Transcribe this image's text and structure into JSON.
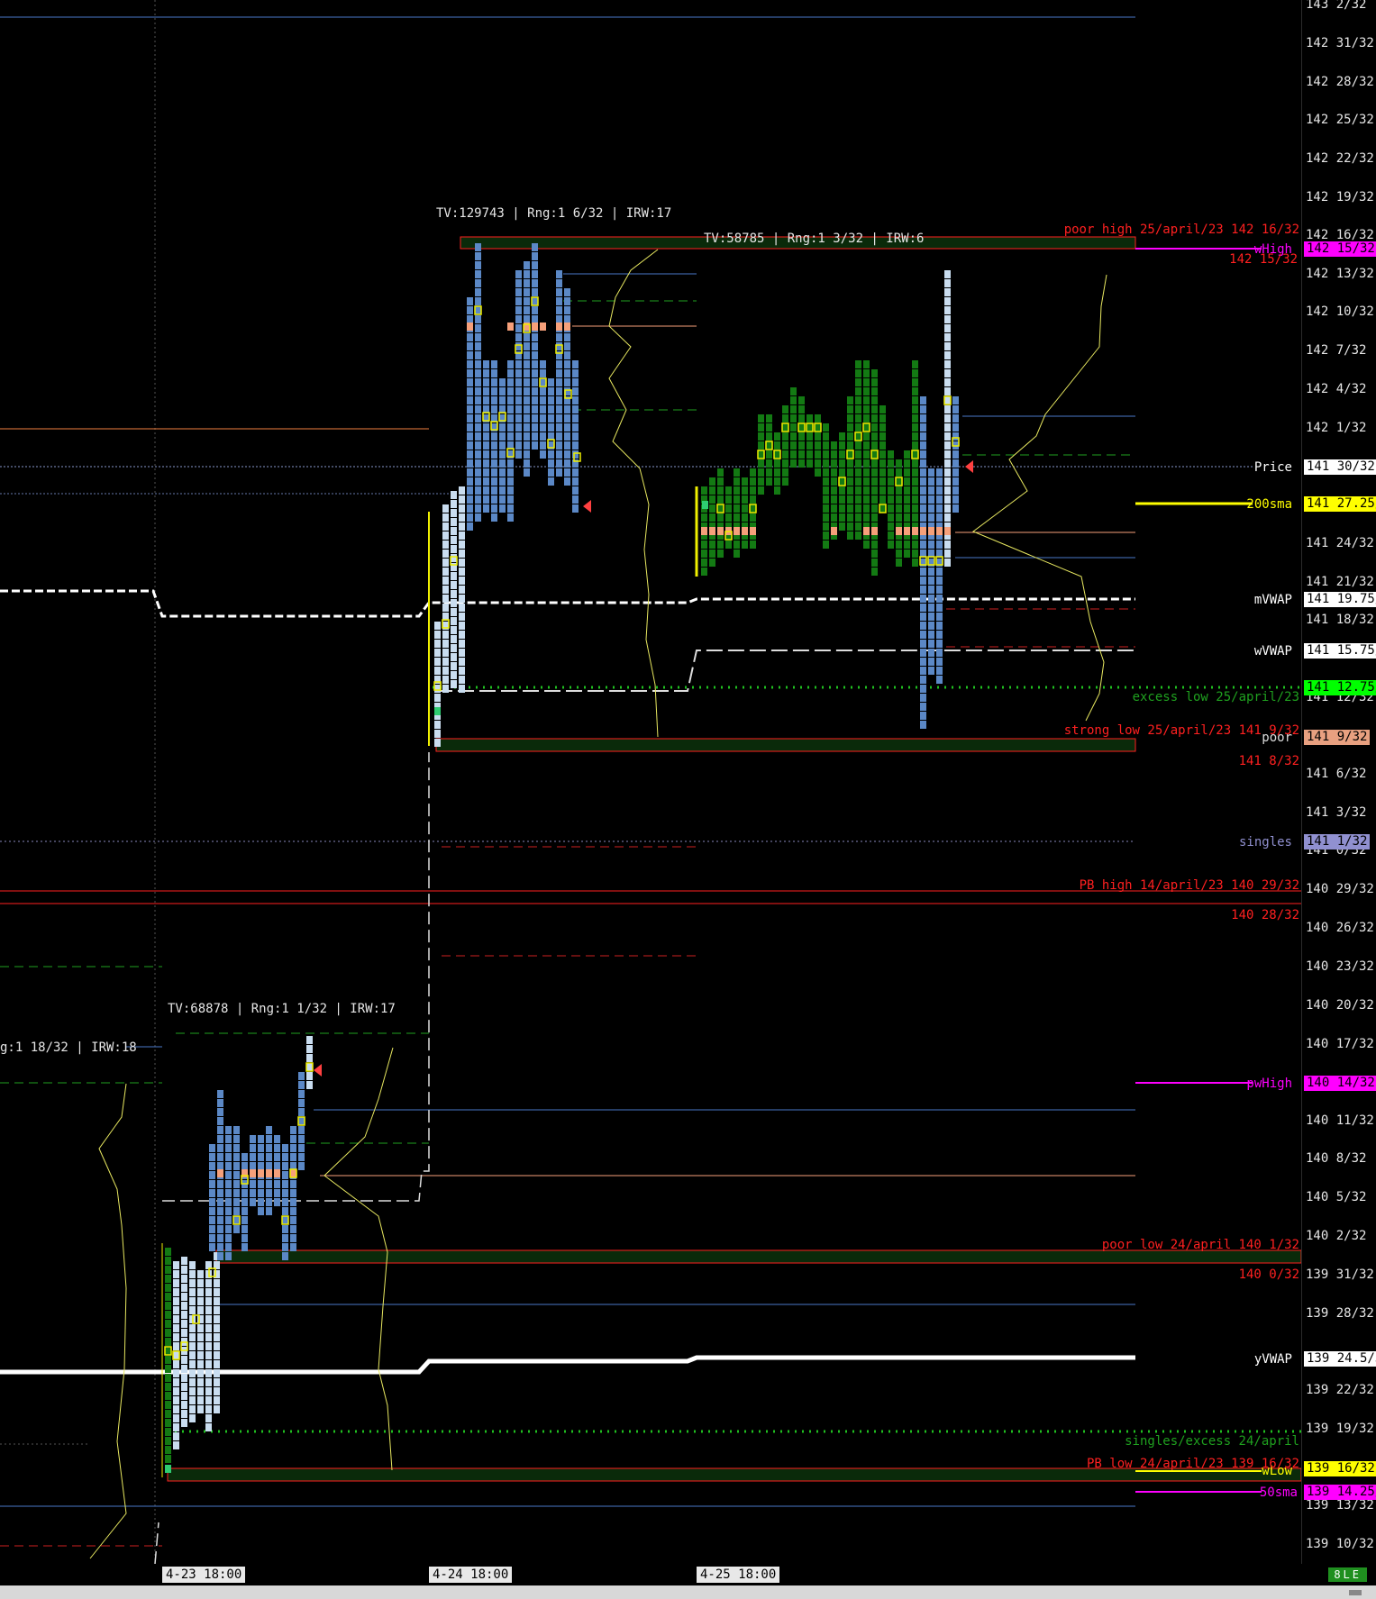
{
  "price_axis": {
    "ticks": [
      "143 2/32",
      "142 31/32",
      "142 28/32",
      "142 25/32",
      "142 22/32",
      "142 19/32",
      "142 16/32",
      "142 13/32",
      "142 10/32",
      "142 7/32",
      "142 4/32",
      "142 1/32",
      "141 24/32",
      "141 21/32",
      "141 18/32",
      "141 12/32",
      "141 6/32",
      "141 3/32",
      "141 0/32",
      "140 29/32",
      "140 26/32",
      "140 23/32",
      "140 20/32",
      "140 17/32",
      "140 11/32",
      "140 8/32",
      "140 5/32",
      "140 2/32",
      "139 31/32",
      "139 28/32",
      "139 22/32",
      "139 19/32",
      "139 13/32",
      "139 10/32"
    ],
    "tags": [
      {
        "text": "142 15/32",
        "bg": "#ff00ff",
        "fg": "#000000"
      },
      {
        "text": "141 30/32",
        "bg": "#ffffff",
        "fg": "#000000"
      },
      {
        "text": "141 27.25/",
        "bg": "#ffff00",
        "fg": "#000000"
      },
      {
        "text": "141 19.75/",
        "bg": "#ffffff",
        "fg": "#000000"
      },
      {
        "text": "141 15.75/",
        "bg": "#ffffff",
        "fg": "#000000"
      },
      {
        "text": "141 12.75/",
        "bg": "#00ff00",
        "fg": "#000000"
      },
      {
        "text": "141 9/32",
        "bg": "#e8a080",
        "fg": "#000000"
      },
      {
        "text": "141 1/32",
        "bg": "#9090d0",
        "fg": "#000000"
      },
      {
        "text": "140 14/32",
        "bg": "#ff00ff",
        "fg": "#000000"
      },
      {
        "text": "139 24.5/3",
        "bg": "#ffffff",
        "fg": "#000000"
      },
      {
        "text": "139 16/32",
        "bg": "#ffff00",
        "fg": "#000000"
      },
      {
        "text": "139 14.25/",
        "bg": "#ff00ff",
        "fg": "#000000"
      }
    ]
  },
  "line_labels": {
    "price": "Price",
    "sma200": "200sma",
    "mvwap": "mVWAP",
    "wvwap": "wVWAP",
    "poor": "poor",
    "singles": "singles",
    "pwhigh": "pwHigh",
    "yvwap": "yVWAP",
    "wlow": "wLow",
    "sma50": "50sma",
    "whigh": "wHigh"
  },
  "annotations": {
    "poor_high": "poor high 25/april/23  142 16/32",
    "poor_high_sub": "142 15/32",
    "excess_low": "excess low 25/april/23",
    "strong_low": "strong low 25/april/23  141 9/32",
    "strong_low_sub": "141 8/32",
    "pb_high": "PB high 14/april/23  140 29/32",
    "pb_high_sub": "140 28/32",
    "poor_low": "poor low 24/april  140 1/32",
    "poor_low_sub": "140 0/32",
    "singles_excess": "singles/excess 24/april",
    "pb_low": "PB low 24/april/23  139 16/32"
  },
  "session_stats": [
    "TV:129743 | Rng:1 6/32 | IRW:17",
    "TV:58785 | Rng:1 3/32 | IRW:6",
    "TV:68878 | Rng:1 1/32 | IRW:17",
    "g:1 18/32 | IRW:18"
  ],
  "time_labels": [
    "4-23  18:00",
    "4-24  18:00",
    "4-25  18:00"
  ],
  "status_badge": "8LE",
  "colors": {
    "profile_blue": "#5b88c6",
    "profile_light": "#c9ddf0",
    "profile_green": "#137a13",
    "poc": "#f6a07a",
    "highlight": "#f0f000",
    "vwap": "#ffffff",
    "excess": "#1fa01f",
    "annotation_red": "#ff2020"
  }
}
